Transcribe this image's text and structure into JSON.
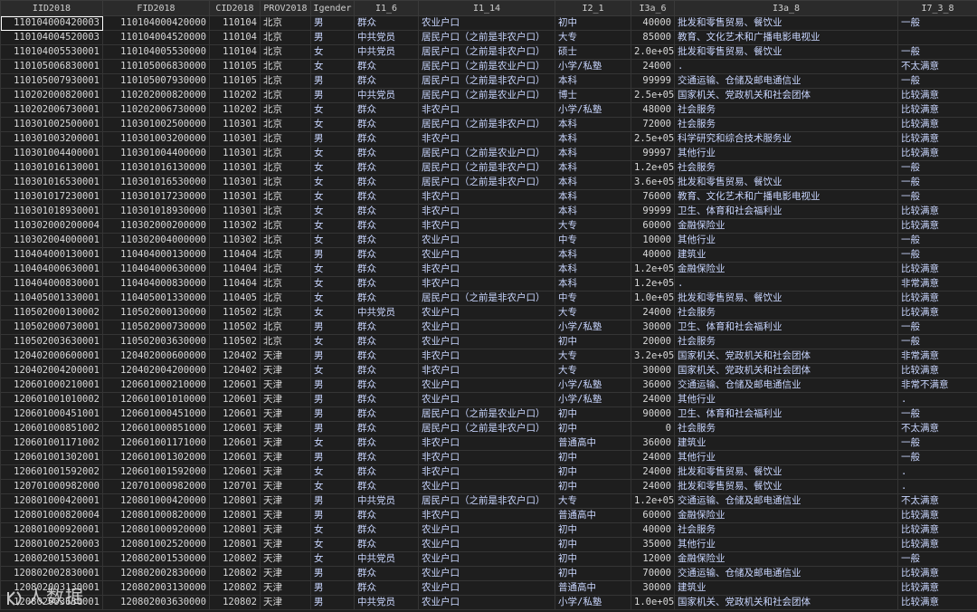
{
  "columns": [
    "IID2018",
    "FID2018",
    "CID2018",
    "PROV2018",
    "Igender",
    "I1_6",
    "I1_14",
    "I2_1",
    "I3a_6",
    "I3a_8",
    "I7_3_8"
  ],
  "rows": [
    [
      "110104000420003",
      "110104000420000",
      "110104",
      "北京",
      "男",
      "群众",
      "农业户口",
      "初中",
      "40000",
      "批发和零售贸易、餐饮业",
      "一般"
    ],
    [
      "110104004520003",
      "110104004520000",
      "110104",
      "北京",
      "男",
      "中共党员",
      "居民户口（之前是非农户口）",
      "大专",
      "85000",
      "教育、文化艺术和广播电影电视业",
      ""
    ],
    [
      "110104005530001",
      "110104005530000",
      "110104",
      "北京",
      "女",
      "中共党员",
      "居民户口（之前是非农户口）",
      "硕士",
      "2.0e+05",
      "批发和零售贸易、餐饮业",
      "一般"
    ],
    [
      "110105006830001",
      "110105006830000",
      "110105",
      "北京",
      "女",
      "群众",
      "居民户口（之前是农业户口）",
      "小学/私塾",
      "24000",
      ".",
      "不太满意"
    ],
    [
      "110105007930001",
      "110105007930000",
      "110105",
      "北京",
      "男",
      "群众",
      "居民户口（之前是非农户口）",
      "本科",
      "99999",
      "交通运输、仓储及邮电通信业",
      "一般"
    ],
    [
      "110202000820001",
      "110202000820000",
      "110202",
      "北京",
      "男",
      "中共党员",
      "居民户口（之前是农业户口）",
      "博士",
      "2.5e+05",
      "国家机关、党政机关和社会团体",
      "比较满意"
    ],
    [
      "110202006730001",
      "110202006730000",
      "110202",
      "北京",
      "女",
      "群众",
      "非农户口",
      "小学/私塾",
      "48000",
      "社会服务",
      "比较满意"
    ],
    [
      "110301002500001",
      "110301002500000",
      "110301",
      "北京",
      "女",
      "群众",
      "居民户口（之前是非农户口）",
      "本科",
      "72000",
      "社会服务",
      "比较满意"
    ],
    [
      "110301003200001",
      "110301003200000",
      "110301",
      "北京",
      "男",
      "群众",
      "非农户口",
      "本科",
      "2.5e+05",
      "科学研究和综合技术服务业",
      "比较满意"
    ],
    [
      "110301004400001",
      "110301004400000",
      "110301",
      "北京",
      "女",
      "群众",
      "居民户口（之前是农业户口）",
      "本科",
      "99997",
      "其他行业",
      "比较满意"
    ],
    [
      "110301016130001",
      "110301016130000",
      "110301",
      "北京",
      "女",
      "群众",
      "居民户口（之前是非农户口）",
      "本科",
      "1.2e+05",
      "社会服务",
      "一般"
    ],
    [
      "110301016530001",
      "110301016530000",
      "110301",
      "北京",
      "女",
      "群众",
      "居民户口（之前是非农户口）",
      "本科",
      "3.6e+05",
      "批发和零售贸易、餐饮业",
      "一般"
    ],
    [
      "110301017230001",
      "110301017230000",
      "110301",
      "北京",
      "女",
      "群众",
      "非农户口",
      "本科",
      "76000",
      "教育、文化艺术和广播电影电视业",
      "一般"
    ],
    [
      "110301018930001",
      "110301018930000",
      "110301",
      "北京",
      "女",
      "群众",
      "非农户口",
      "本科",
      "99999",
      "卫生、体育和社会福利业",
      "比较满意"
    ],
    [
      "110302000200004",
      "110302000200000",
      "110302",
      "北京",
      "女",
      "群众",
      "非农户口",
      "大专",
      "60000",
      "金融保险业",
      "比较满意"
    ],
    [
      "110302004000001",
      "110302004000000",
      "110302",
      "北京",
      "女",
      "群众",
      "农业户口",
      "中专",
      "10000",
      "其他行业",
      "一般"
    ],
    [
      "110404000130001",
      "110404000130000",
      "110404",
      "北京",
      "男",
      "群众",
      "农业户口",
      "本科",
      "40000",
      "建筑业",
      "一般"
    ],
    [
      "110404000630001",
      "110404000630000",
      "110404",
      "北京",
      "女",
      "群众",
      "非农户口",
      "本科",
      "1.2e+05",
      "金融保险业",
      "比较满意"
    ],
    [
      "110404000830001",
      "110404000830000",
      "110404",
      "北京",
      "女",
      "群众",
      "非农户口",
      "本科",
      "1.2e+05",
      ".",
      "非常满意"
    ],
    [
      "110405001330001",
      "110405001330000",
      "110405",
      "北京",
      "女",
      "群众",
      "居民户口（之前是非农户口）",
      "中专",
      "1.0e+05",
      "批发和零售贸易、餐饮业",
      "比较满意"
    ],
    [
      "110502000130002",
      "110502000130000",
      "110502",
      "北京",
      "女",
      "中共党员",
      "农业户口",
      "大专",
      "24000",
      "社会服务",
      "比较满意"
    ],
    [
      "110502000730001",
      "110502000730000",
      "110502",
      "北京",
      "男",
      "群众",
      "农业户口",
      "小学/私塾",
      "30000",
      "卫生、体育和社会福利业",
      "一般"
    ],
    [
      "110502003630001",
      "110502003630000",
      "110502",
      "北京",
      "女",
      "群众",
      "农业户口",
      "初中",
      "20000",
      "社会服务",
      "一般"
    ],
    [
      "120402000600001",
      "120402000600000",
      "120402",
      "天津",
      "男",
      "群众",
      "非农户口",
      "大专",
      "3.2e+05",
      "国家机关、党政机关和社会团体",
      "非常满意"
    ],
    [
      "120402004200001",
      "120402004200000",
      "120402",
      "天津",
      "女",
      "群众",
      "非农户口",
      "大专",
      "30000",
      "国家机关、党政机关和社会团体",
      "比较满意"
    ],
    [
      "120601000210001",
      "120601000210000",
      "120601",
      "天津",
      "男",
      "群众",
      "农业户口",
      "小学/私塾",
      "36000",
      "交通运输、仓储及邮电通信业",
      "非常不满意"
    ],
    [
      "120601001010002",
      "120601001010000",
      "120601",
      "天津",
      "男",
      "群众",
      "农业户口",
      "小学/私塾",
      "24000",
      "其他行业",
      "."
    ],
    [
      "120601000451001",
      "120601000451000",
      "120601",
      "天津",
      "男",
      "群众",
      "居民户口（之前是农业户口）",
      "初中",
      "90000",
      "卫生、体育和社会福利业",
      "一般"
    ],
    [
      "120601000851002",
      "120601000851000",
      "120601",
      "天津",
      "男",
      "群众",
      "居民户口（之前是非农户口）",
      "初中",
      "0",
      "社会服务",
      "不太满意"
    ],
    [
      "120601001171002",
      "120601001171000",
      "120601",
      "天津",
      "女",
      "群众",
      "非农户口",
      "普通高中",
      "36000",
      "建筑业",
      "一般"
    ],
    [
      "120601001302001",
      "120601001302000",
      "120601",
      "天津",
      "男",
      "群众",
      "非农户口",
      "初中",
      "24000",
      "其他行业",
      "一般"
    ],
    [
      "120601001592002",
      "120601001592000",
      "120601",
      "天津",
      "女",
      "群众",
      "非农户口",
      "初中",
      "24000",
      "批发和零售贸易、餐饮业",
      "."
    ],
    [
      "120701000982000",
      "120701000982000",
      "120701",
      "天津",
      "女",
      "群众",
      "农业户口",
      "初中",
      "24000",
      "批发和零售贸易、餐饮业",
      "."
    ],
    [
      "120801000420001",
      "120801000420000",
      "120801",
      "天津",
      "男",
      "中共党员",
      "居民户口（之前是非农户口）",
      "大专",
      "1.2e+05",
      "交通运输、仓储及邮电通信业",
      "不太满意"
    ],
    [
      "120801000820004",
      "120801000820000",
      "120801",
      "天津",
      "男",
      "群众",
      "非农户口",
      "普通高中",
      "60000",
      "金融保险业",
      "比较满意"
    ],
    [
      "120801000920001",
      "120801000920000",
      "120801",
      "天津",
      "女",
      "群众",
      "农业户口",
      "初中",
      "40000",
      "社会服务",
      "比较满意"
    ],
    [
      "120801002520003",
      "120801002520000",
      "120801",
      "天津",
      "女",
      "群众",
      "农业户口",
      "初中",
      "35000",
      "其他行业",
      "比较满意"
    ],
    [
      "120802001530001",
      "120802001530000",
      "120802",
      "天津",
      "女",
      "中共党员",
      "农业户口",
      "初中",
      "12000",
      "金融保险业",
      "一般"
    ],
    [
      "120802002830001",
      "120802002830000",
      "120802",
      "天津",
      "男",
      "群众",
      "农业户口",
      "初中",
      "70000",
      "交通运输、仓储及邮电通信业",
      "比较满意"
    ],
    [
      "120802003130001",
      "120802003130000",
      "120802",
      "天津",
      "男",
      "群众",
      "农业户口",
      "普通高中",
      "30000",
      "建筑业",
      "比较满意"
    ],
    [
      "120802003630001",
      "120802003630000",
      "120802",
      "天津",
      "男",
      "中共党员",
      "农业户口",
      "小学/私塾",
      "1.0e+05",
      "国家机关、党政机关和社会团体",
      "比较满意"
    ]
  ],
  "watermark": "人数据",
  "colors": {
    "background": "#1e1e1e",
    "header": "#2b2b2b",
    "label_text": "#c9d6ff",
    "selected_outline": "#ffffff"
  }
}
